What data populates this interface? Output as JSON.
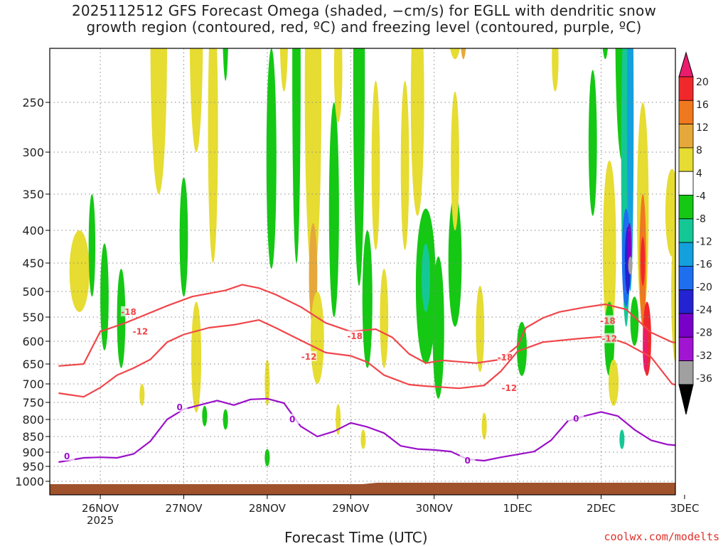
{
  "title_line1": "2025112512 GFS Forecast Omega (shaded, −cm/s) for EGLL with dendritic snow",
  "title_line2": "growth region (contoured, red, ºC) and freezing level (contoured, purple, ºC)",
  "xlabel": "Forecast Time (UTC)",
  "credit": "coolwx.com/modelts",
  "colors": {
    "background": "#ffffff",
    "terrain": "#a0522d",
    "dgz_line": "#f0464a",
    "freezing_line": "#9a10c8",
    "grid": "#888888"
  },
  "chart_data": {
    "type": "heatmap",
    "x_ticks": [
      {
        "t": 0.5,
        "label": "26NOV",
        "sublabel": "2025"
      },
      {
        "t": 1.5,
        "label": "27NOV"
      },
      {
        "t": 2.5,
        "label": "28NOV"
      },
      {
        "t": 3.5,
        "label": "29NOV"
      },
      {
        "t": 4.5,
        "label": "30NOV"
      },
      {
        "t": 5.5,
        "label": "1DEC"
      },
      {
        "t": 6.5,
        "label": "2DEC"
      },
      {
        "t": 7.5,
        "label": "3DEC"
      }
    ],
    "y_ticks": [
      250,
      300,
      350,
      400,
      450,
      500,
      550,
      600,
      650,
      700,
      750,
      800,
      850,
      900,
      950,
      1000
    ],
    "x_range_days": [
      0,
      7.5
    ],
    "y_range_hpa": [
      200,
      1020
    ],
    "y_scale": "log-pressure",
    "colorbar": {
      "labels": [
        "20",
        "16",
        "12",
        "8",
        "4",
        "-4",
        "-8",
        "-12",
        "-16",
        "-20",
        "-24",
        "-28",
        "-32",
        "-36"
      ],
      "colors": [
        "#ec1c6c",
        "#f0282c",
        "#f0781e",
        "#e6a83a",
        "#e6dc32",
        "#ffffff",
        "#14c814",
        "#14c896",
        "#14a0dc",
        "#1e6ef0",
        "#2323d2",
        "#7800c8",
        "#a014d2",
        "#a0a0a0",
        "#000000"
      ]
    },
    "series": [
      {
        "name": "-18",
        "color": "#f0464a",
        "label_points": [
          [
            0.84,
            540
          ],
          [
            3.55,
            590
          ],
          [
            5.35,
            636
          ],
          [
            6.58,
            558
          ]
        ],
        "points": [
          [
            0,
            655
          ],
          [
            0.3,
            650
          ],
          [
            0.5,
            580
          ],
          [
            0.8,
            562
          ],
          [
            1.0,
            548
          ],
          [
            1.3,
            528
          ],
          [
            1.6,
            510
          ],
          [
            2.0,
            498
          ],
          [
            2.2,
            488
          ],
          [
            2.4,
            494
          ],
          [
            2.6,
            506
          ],
          [
            2.9,
            530
          ],
          [
            3.2,
            562
          ],
          [
            3.5,
            580
          ],
          [
            3.8,
            575
          ],
          [
            4.0,
            592
          ],
          [
            4.2,
            628
          ],
          [
            4.4,
            648
          ],
          [
            4.6,
            642
          ],
          [
            5.0,
            648
          ],
          [
            5.3,
            640
          ],
          [
            5.5,
            610
          ],
          [
            5.6,
            572
          ],
          [
            5.8,
            552
          ],
          [
            6.0,
            540
          ],
          [
            6.3,
            531
          ],
          [
            6.55,
            525
          ],
          [
            6.8,
            535
          ],
          [
            7.1,
            582
          ],
          [
            7.35,
            602
          ],
          [
            7.5,
            605
          ]
        ]
      },
      {
        "name": "-12",
        "color": "#f0464a",
        "label_points": [
          [
            0.98,
            580
          ],
          [
            3.0,
            634
          ],
          [
            5.4,
            712
          ],
          [
            6.6,
            595
          ]
        ],
        "points": [
          [
            0,
            725
          ],
          [
            0.3,
            735
          ],
          [
            0.5,
            710
          ],
          [
            0.7,
            678
          ],
          [
            0.9,
            660
          ],
          [
            1.1,
            640
          ],
          [
            1.3,
            602
          ],
          [
            1.5,
            586
          ],
          [
            1.8,
            572
          ],
          [
            2.1,
            566
          ],
          [
            2.4,
            556
          ],
          [
            2.6,
            572
          ],
          [
            2.9,
            598
          ],
          [
            3.2,
            625
          ],
          [
            3.5,
            632
          ],
          [
            3.7,
            646
          ],
          [
            3.9,
            678
          ],
          [
            4.2,
            702
          ],
          [
            4.4,
            706
          ],
          [
            4.8,
            712
          ],
          [
            5.1,
            704
          ],
          [
            5.3,
            668
          ],
          [
            5.5,
            622
          ],
          [
            5.8,
            602
          ],
          [
            6.2,
            595
          ],
          [
            6.55,
            590
          ],
          [
            6.8,
            605
          ],
          [
            7.1,
            635
          ],
          [
            7.35,
            700
          ],
          [
            7.5,
            708
          ]
        ]
      },
      {
        "name": "0",
        "color": "#9a10c8",
        "label_points": [
          [
            0.1,
            915
          ],
          [
            1.45,
            765
          ],
          [
            2.8,
            800
          ],
          [
            4.9,
            930
          ],
          [
            6.2,
            798
          ]
        ],
        "points": [
          [
            0,
            935
          ],
          [
            0.3,
            920
          ],
          [
            0.5,
            918
          ],
          [
            0.7,
            920
          ],
          [
            0.9,
            906
          ],
          [
            1.1,
            865
          ],
          [
            1.3,
            800
          ],
          [
            1.5,
            770
          ],
          [
            1.7,
            757
          ],
          [
            1.9,
            745
          ],
          [
            2.1,
            758
          ],
          [
            2.3,
            742
          ],
          [
            2.5,
            740
          ],
          [
            2.7,
            752
          ],
          [
            2.9,
            820
          ],
          [
            3.1,
            850
          ],
          [
            3.3,
            835
          ],
          [
            3.5,
            810
          ],
          [
            3.7,
            822
          ],
          [
            3.9,
            840
          ],
          [
            4.1,
            880
          ],
          [
            4.3,
            890
          ],
          [
            4.5,
            893
          ],
          [
            4.7,
            898
          ],
          [
            4.9,
            925
          ],
          [
            5.1,
            930
          ],
          [
            5.3,
            918
          ],
          [
            5.5,
            908
          ],
          [
            5.7,
            898
          ],
          [
            5.9,
            862
          ],
          [
            6.1,
            805
          ],
          [
            6.3,
            790
          ],
          [
            6.5,
            778
          ],
          [
            6.7,
            790
          ],
          [
            6.9,
            830
          ],
          [
            7.1,
            862
          ],
          [
            7.3,
            876
          ],
          [
            7.5,
            880
          ]
        ]
      }
    ],
    "ylabel": "",
    "grid": true
  }
}
